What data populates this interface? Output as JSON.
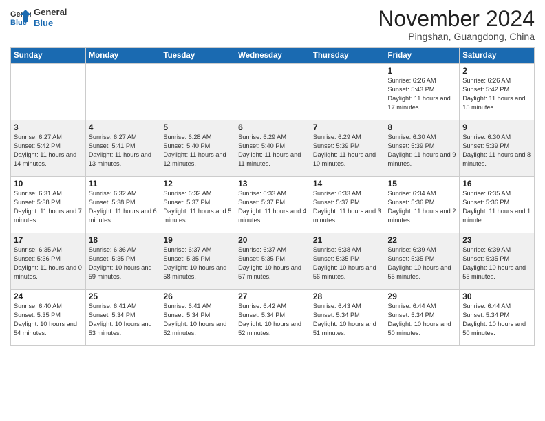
{
  "header": {
    "logo_general": "General",
    "logo_blue": "Blue",
    "month_title": "November 2024",
    "location": "Pingshan, Guangdong, China"
  },
  "days_of_week": [
    "Sunday",
    "Monday",
    "Tuesday",
    "Wednesday",
    "Thursday",
    "Friday",
    "Saturday"
  ],
  "weeks": [
    [
      {
        "day": "",
        "info": ""
      },
      {
        "day": "",
        "info": ""
      },
      {
        "day": "",
        "info": ""
      },
      {
        "day": "",
        "info": ""
      },
      {
        "day": "",
        "info": ""
      },
      {
        "day": "1",
        "info": "Sunrise: 6:26 AM\nSunset: 5:43 PM\nDaylight: 11 hours and 17 minutes."
      },
      {
        "day": "2",
        "info": "Sunrise: 6:26 AM\nSunset: 5:42 PM\nDaylight: 11 hours and 15 minutes."
      }
    ],
    [
      {
        "day": "3",
        "info": "Sunrise: 6:27 AM\nSunset: 5:42 PM\nDaylight: 11 hours and 14 minutes."
      },
      {
        "day": "4",
        "info": "Sunrise: 6:27 AM\nSunset: 5:41 PM\nDaylight: 11 hours and 13 minutes."
      },
      {
        "day": "5",
        "info": "Sunrise: 6:28 AM\nSunset: 5:40 PM\nDaylight: 11 hours and 12 minutes."
      },
      {
        "day": "6",
        "info": "Sunrise: 6:29 AM\nSunset: 5:40 PM\nDaylight: 11 hours and 11 minutes."
      },
      {
        "day": "7",
        "info": "Sunrise: 6:29 AM\nSunset: 5:39 PM\nDaylight: 11 hours and 10 minutes."
      },
      {
        "day": "8",
        "info": "Sunrise: 6:30 AM\nSunset: 5:39 PM\nDaylight: 11 hours and 9 minutes."
      },
      {
        "day": "9",
        "info": "Sunrise: 6:30 AM\nSunset: 5:39 PM\nDaylight: 11 hours and 8 minutes."
      }
    ],
    [
      {
        "day": "10",
        "info": "Sunrise: 6:31 AM\nSunset: 5:38 PM\nDaylight: 11 hours and 7 minutes."
      },
      {
        "day": "11",
        "info": "Sunrise: 6:32 AM\nSunset: 5:38 PM\nDaylight: 11 hours and 6 minutes."
      },
      {
        "day": "12",
        "info": "Sunrise: 6:32 AM\nSunset: 5:37 PM\nDaylight: 11 hours and 5 minutes."
      },
      {
        "day": "13",
        "info": "Sunrise: 6:33 AM\nSunset: 5:37 PM\nDaylight: 11 hours and 4 minutes."
      },
      {
        "day": "14",
        "info": "Sunrise: 6:33 AM\nSunset: 5:37 PM\nDaylight: 11 hours and 3 minutes."
      },
      {
        "day": "15",
        "info": "Sunrise: 6:34 AM\nSunset: 5:36 PM\nDaylight: 11 hours and 2 minutes."
      },
      {
        "day": "16",
        "info": "Sunrise: 6:35 AM\nSunset: 5:36 PM\nDaylight: 11 hours and 1 minute."
      }
    ],
    [
      {
        "day": "17",
        "info": "Sunrise: 6:35 AM\nSunset: 5:36 PM\nDaylight: 11 hours and 0 minutes."
      },
      {
        "day": "18",
        "info": "Sunrise: 6:36 AM\nSunset: 5:35 PM\nDaylight: 10 hours and 59 minutes."
      },
      {
        "day": "19",
        "info": "Sunrise: 6:37 AM\nSunset: 5:35 PM\nDaylight: 10 hours and 58 minutes."
      },
      {
        "day": "20",
        "info": "Sunrise: 6:37 AM\nSunset: 5:35 PM\nDaylight: 10 hours and 57 minutes."
      },
      {
        "day": "21",
        "info": "Sunrise: 6:38 AM\nSunset: 5:35 PM\nDaylight: 10 hours and 56 minutes."
      },
      {
        "day": "22",
        "info": "Sunrise: 6:39 AM\nSunset: 5:35 PM\nDaylight: 10 hours and 55 minutes."
      },
      {
        "day": "23",
        "info": "Sunrise: 6:39 AM\nSunset: 5:35 PM\nDaylight: 10 hours and 55 minutes."
      }
    ],
    [
      {
        "day": "24",
        "info": "Sunrise: 6:40 AM\nSunset: 5:35 PM\nDaylight: 10 hours and 54 minutes."
      },
      {
        "day": "25",
        "info": "Sunrise: 6:41 AM\nSunset: 5:34 PM\nDaylight: 10 hours and 53 minutes."
      },
      {
        "day": "26",
        "info": "Sunrise: 6:41 AM\nSunset: 5:34 PM\nDaylight: 10 hours and 52 minutes."
      },
      {
        "day": "27",
        "info": "Sunrise: 6:42 AM\nSunset: 5:34 PM\nDaylight: 10 hours and 52 minutes."
      },
      {
        "day": "28",
        "info": "Sunrise: 6:43 AM\nSunset: 5:34 PM\nDaylight: 10 hours and 51 minutes."
      },
      {
        "day": "29",
        "info": "Sunrise: 6:44 AM\nSunset: 5:34 PM\nDaylight: 10 hours and 50 minutes."
      },
      {
        "day": "30",
        "info": "Sunrise: 6:44 AM\nSunset: 5:34 PM\nDaylight: 10 hours and 50 minutes."
      }
    ]
  ]
}
